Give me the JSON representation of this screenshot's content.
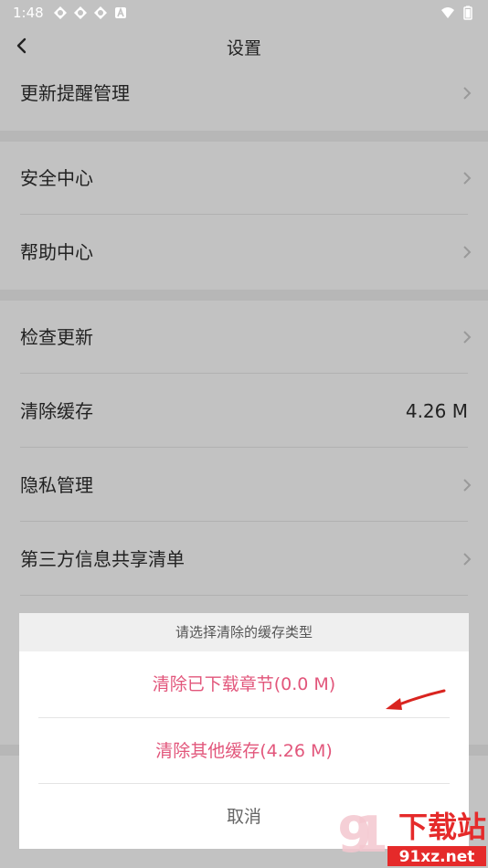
{
  "status_bar": {
    "time": "1:48"
  },
  "header": {
    "title": "设置"
  },
  "settings": {
    "update_reminder": "更新提醒管理",
    "security_center": "安全中心",
    "help_center": "帮助中心",
    "check_update": "检查更新",
    "clear_cache": "清除缓存",
    "clear_cache_value": "4.26 M",
    "privacy": "隐私管理",
    "third_party": "第三方信息共享清单"
  },
  "dialog": {
    "title": "请选择清除的缓存类型",
    "option_downloaded": "清除已下载章节(0.0 M)",
    "option_other": "清除其他缓存(4.26 M)",
    "cancel": "取消"
  },
  "colors": {
    "accent": "#e2567b",
    "arrow": "#d9241f",
    "watermark": "#e52a2a"
  },
  "watermark": {
    "big": "下载站",
    "small": "91xz.net"
  }
}
